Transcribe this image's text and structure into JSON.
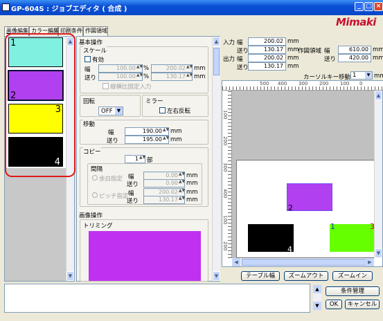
{
  "window": {
    "title": "GP-604S : ジョブエディタ ( 合成 )",
    "brand": "Mimaki"
  },
  "tabs": [
    "画像編集",
    "カラー編集",
    "印刷条件",
    "作図領域"
  ],
  "thumbnails": [
    {
      "num": "1",
      "color": "#80f0e0"
    },
    {
      "num": "2",
      "color": "#b040f0"
    },
    {
      "num": "3",
      "color": "#ffff00"
    },
    {
      "num": "4",
      "color": "#000000"
    }
  ],
  "basic": {
    "section": "基本操作",
    "scale_label": "スケール",
    "enable_label": "有効",
    "width_label": "幅",
    "feed_label": "送り",
    "w_pct": "100.00",
    "w_mm": "200.02",
    "f_pct": "100.00",
    "f_mm": "130.17",
    "pct": "%",
    "mm": "mm",
    "aspect_label": "縦横比固定入力"
  },
  "rotate": {
    "label": "回転",
    "value": "OFF",
    "mirror_label": "ミラー",
    "mirror_option": "左右反転"
  },
  "move": {
    "label": "移動",
    "width_label": "幅",
    "feed_label": "送り",
    "width": "190.00",
    "feed": "195.00",
    "mm": "mm"
  },
  "copy": {
    "label": "コピー",
    "count": "1",
    "unit": "部",
    "gap_label": "間隔",
    "blank_label": "余白指定",
    "pitch_label": "ピッチ指定",
    "width_label": "幅",
    "feed_label": "送り",
    "blank_w": "0.00",
    "blank_f": "0.00",
    "pitch_w": "200.02",
    "pitch_f": "130.17",
    "mm": "mm"
  },
  "image_ops": {
    "section": "画像操作",
    "trim_label": "トリミング",
    "preview_color": "#c030f0"
  },
  "info": {
    "input_label": "入力",
    "output_label": "出力",
    "width_label": "幅",
    "feed_label": "送り",
    "in_w": "200.02",
    "in_f": "130.17",
    "out_w": "200.02",
    "out_f": "130.17",
    "area_label": "作図領域",
    "area_width_label": "幅",
    "area_feed_label": "送り",
    "area_w": "610.00",
    "area_f": "420.00",
    "mm": "mm"
  },
  "cursor": {
    "label": "カーソルキー移動量",
    "value": "1",
    "mm": "mm"
  },
  "ruler": {
    "h": [
      "500",
      "400",
      "300",
      "200",
      "100",
      "0"
    ],
    "v": [
      "100",
      "200",
      "300",
      "400",
      "100",
      "200"
    ]
  },
  "canvas": {
    "items": [
      {
        "num": "2",
        "color": "#b040f0"
      },
      {
        "num": "4",
        "color": "#000000"
      },
      {
        "num": "1",
        "color": "#66ff00"
      },
      {
        "num": "3",
        "color": "#66ff00"
      }
    ]
  },
  "buttons": {
    "table_width": "テーブル幅",
    "zoom_out": "ズームアウト",
    "zoom_in": "ズームイン",
    "condition": "条件管理",
    "ok": "OK",
    "cancel": "キャンセル"
  }
}
